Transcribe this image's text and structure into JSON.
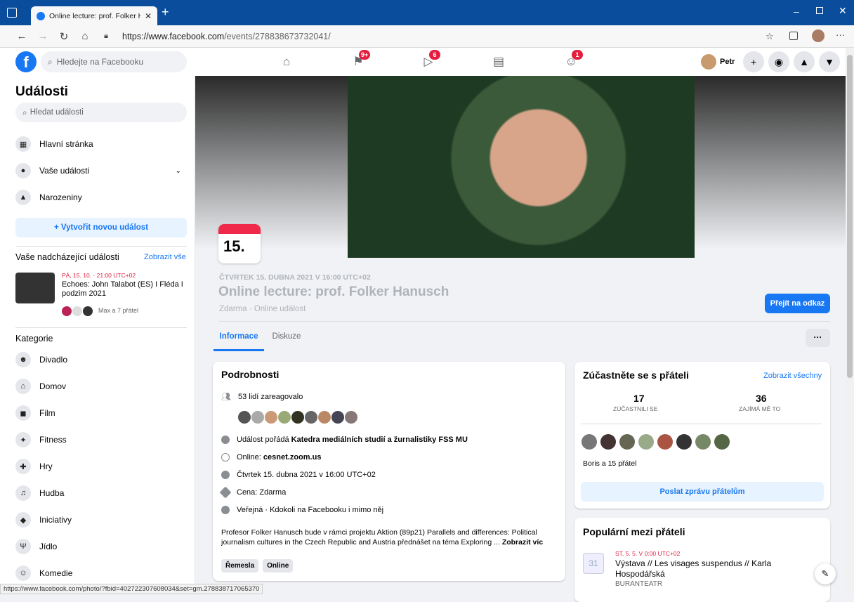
{
  "browser": {
    "tab_title": "Online lecture: prof. Folker Hanu",
    "url_host": "https://www.facebook.com",
    "url_path": "/events/278838673732041/"
  },
  "fbheader": {
    "search_placeholder": "Hledejte na Facebooku",
    "badges": {
      "pages": "9+",
      "watch": "6",
      "groups": "1"
    },
    "user_name": "Petr"
  },
  "sidebar": {
    "title": "Události",
    "search_placeholder": "Hledat události",
    "items": [
      {
        "label": "Hlavní stránka"
      },
      {
        "label": "Vaše události"
      },
      {
        "label": "Narozeniny"
      }
    ],
    "create_button": "+ Vytvořit novou událost",
    "upcoming_title": "Vaše nadcházející události",
    "upcoming_show_all": "Zobrazit vše",
    "upcoming_event": {
      "date": "PÁ, 15. 10. · 21:00 UTC+02",
      "title": "Echoes: John Talabot (ES) I Fléda I podzim 2021",
      "friends": "Max a 7 přátel"
    },
    "categories_title": "Kategorie",
    "categories": [
      "Divadlo",
      "Domov",
      "Film",
      "Fitness",
      "Hry",
      "Hudba",
      "Iniciativy",
      "Jídlo",
      "Komedie"
    ]
  },
  "event": {
    "day": "15.",
    "datetime": "ČTVRTEK 15. DUBNA 2021 V 16:00 UTC+02",
    "title": "Online lecture: prof. Folker Hanusch",
    "subtitle": "Zdarma · Online událost",
    "go_button": "Přejít na odkaz",
    "tabs": [
      "Informace",
      "Diskuze"
    ],
    "more": "···"
  },
  "details": {
    "title": "Podrobnosti",
    "reacted": "53 lidí zareagovalo",
    "host_prefix": "Událost pořádá ",
    "host": "Katedra mediálních studií a žurnalistiky FSS MU",
    "online_prefix": "Online: ",
    "online": "cesnet.zoom.us",
    "time": "Čtvrtek 15. dubna 2021 v 16:00 UTC+02",
    "price": "Cena: Zdarma",
    "visibility": "Veřejná · Kdokoli na Facebooku i mimo něj",
    "description": "Profesor Folker Hanusch bude v rámci projektu Aktion (89p21) Parallels and differences: Political journalism cultures in the Czech Republic and Austria přednášet na téma Exploring ...",
    "show_more": "Zobrazit víc",
    "tags": [
      "Řemesla",
      "Online"
    ]
  },
  "friends": {
    "title": "Zúčastněte se s přáteli",
    "show_all": "Zobrazit všechny",
    "attended_count": "17",
    "attended_label": "ZÚČASTNILI SE",
    "interested_count": "36",
    "interested_label": "ZAJÍMÁ MĚ TO",
    "summary": "Boris a 15 přátel",
    "message_button": "Poslat zprávu přátelům"
  },
  "popular": {
    "title": "Populární mezi přáteli",
    "date": "ST, 5. 5. V 0:00 UTC+02",
    "event_title": "Výstava // Les visages suspendus // Karla Hospodářská",
    "venue": "BURANTEATR",
    "calendar_day": "31"
  },
  "status_url": "https://www.facebook.com/photo/?fbid=402722307608034&set=gm.278838717065370"
}
